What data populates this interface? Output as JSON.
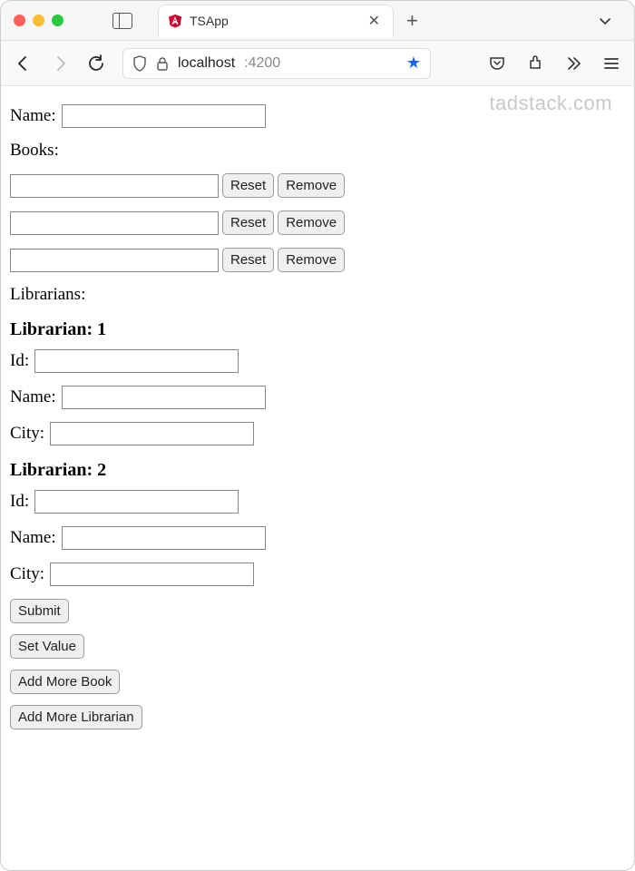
{
  "browser": {
    "tab_title": "TSApp",
    "url_host": "localhost",
    "url_port": ":4200"
  },
  "watermark": "tadstack.com",
  "form": {
    "name_label": "Name:",
    "books_label": "Books:",
    "librarians_label": "Librarians:",
    "book_rows": [
      {
        "value": "",
        "reset_label": "Reset",
        "remove_label": "Remove"
      },
      {
        "value": "",
        "reset_label": "Reset",
        "remove_label": "Remove"
      },
      {
        "value": "",
        "reset_label": "Reset",
        "remove_label": "Remove"
      }
    ],
    "librarians": [
      {
        "heading": "Librarian: 1",
        "id_label": "Id:",
        "name_label": "Name:",
        "city_label": "City:",
        "id_value": "",
        "name_value": "",
        "city_value": ""
      },
      {
        "heading": "Librarian: 2",
        "id_label": "Id:",
        "name_label": "Name:",
        "city_label": "City:",
        "id_value": "",
        "name_value": "",
        "city_value": ""
      }
    ],
    "submit_label": "Submit",
    "set_value_label": "Set Value",
    "add_book_label": "Add More Book",
    "add_librarian_label": "Add More Librarian"
  }
}
